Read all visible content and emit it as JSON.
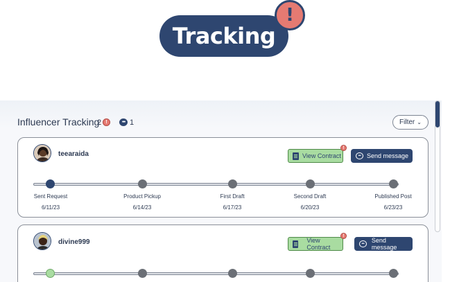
{
  "header": {
    "title": "Tracking",
    "alert_glyph": "!"
  },
  "panel": {
    "title": "Influencer Tracking",
    "count_alerts": "2",
    "count_messages": "1",
    "filter_label": "Filter"
  },
  "cards": [
    {
      "username": "teearaida",
      "contract_label": "View Contract",
      "message_label": "Send message",
      "steps": [
        {
          "label": "Sent Request",
          "date": "6/11/23",
          "state": "active"
        },
        {
          "label": "Product Pickup",
          "date": "6/14/23",
          "state": "pending"
        },
        {
          "label": "First Draft",
          "date": "6/17/23",
          "state": "pending"
        },
        {
          "label": "Second Draft",
          "date": "6/20/23",
          "state": "pending"
        },
        {
          "label": "Published Post",
          "date": "6/23/23",
          "state": "pending"
        }
      ]
    },
    {
      "username": "divine999",
      "contract_label": "View Contract",
      "message_label": "Send message",
      "steps": [
        {
          "state": "done"
        },
        {
          "state": "pending"
        },
        {
          "state": "pending"
        },
        {
          "state": "pending"
        },
        {
          "state": "pending"
        }
      ]
    }
  ],
  "icons": {
    "alert": "alert-icon",
    "chat": "chat-icon",
    "contract": "document-icon",
    "message": "message-icon",
    "chevron": "chevron-down-icon"
  },
  "colors": {
    "brand_navy": "#2e4670",
    "alert_red": "#e57a72",
    "contract_green": "#a9dca1"
  }
}
